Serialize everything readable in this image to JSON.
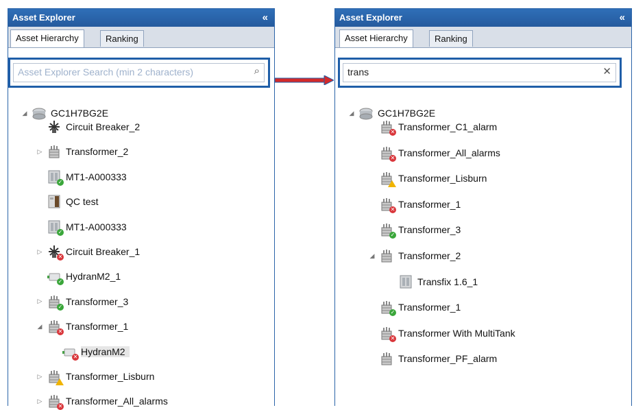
{
  "left": {
    "title": "Asset Explorer",
    "collapse_glyph": "«",
    "tabs": [
      "Asset Hierarchy",
      "Ranking"
    ],
    "search": {
      "placeholder": "Asset Explorer Search (min 2 characters)",
      "value": "",
      "button_icon": "search-icon"
    },
    "root": "GC1H7BG2E",
    "items": [
      {
        "label": "Circuit Breaker_2",
        "icon": "circuit-breaker-icon",
        "status": "none",
        "expander": "none"
      },
      {
        "label": "Transformer_2",
        "icon": "transformer-icon",
        "status": "none",
        "expander": "collapsed"
      },
      {
        "label": "MT1-A000333",
        "icon": "monitor-device-icon",
        "status": "ok",
        "expander": "none"
      },
      {
        "label": "QC test",
        "icon": "cabinet-icon",
        "status": "none",
        "expander": "none"
      },
      {
        "label": "MT1-A000333",
        "icon": "monitor-device-icon",
        "status": "ok",
        "expander": "none"
      },
      {
        "label": "Circuit Breaker_1",
        "icon": "circuit-breaker-icon",
        "status": "error",
        "expander": "collapsed"
      },
      {
        "label": "HydranM2_1",
        "icon": "hydran-sensor-icon",
        "status": "ok",
        "expander": "none"
      },
      {
        "label": "Transformer_3",
        "icon": "transformer-icon",
        "status": "ok",
        "expander": "collapsed"
      },
      {
        "label": "Transformer_1",
        "icon": "transformer-icon",
        "status": "error",
        "expander": "expanded"
      },
      {
        "label": "HydranM2",
        "icon": "hydran-sensor-icon",
        "status": "error",
        "expander": "none",
        "child": true,
        "selected": true
      },
      {
        "label": "Transformer_Lisburn",
        "icon": "transformer-icon",
        "status": "warning",
        "expander": "collapsed"
      },
      {
        "label": "Transformer_All_alarms",
        "icon": "transformer-icon",
        "status": "error",
        "expander": "collapsed"
      }
    ]
  },
  "right": {
    "title": "Asset Explorer",
    "collapse_glyph": "«",
    "tabs": [
      "Asset Hierarchy",
      "Ranking"
    ],
    "search": {
      "placeholder": "",
      "value": "trans",
      "button_icon": "clear-icon"
    },
    "root": "GC1H7BG2E",
    "items": [
      {
        "label": "Transformer_C1_alarm",
        "icon": "transformer-icon",
        "status": "error",
        "expander": "none"
      },
      {
        "label": "Transformer_All_alarms",
        "icon": "transformer-icon",
        "status": "error",
        "expander": "none"
      },
      {
        "label": "Transformer_Lisburn",
        "icon": "transformer-icon",
        "status": "warning",
        "expander": "none"
      },
      {
        "label": "Transformer_1",
        "icon": "transformer-icon",
        "status": "error",
        "expander": "none"
      },
      {
        "label": "Transformer_3",
        "icon": "transformer-icon",
        "status": "ok",
        "expander": "none"
      },
      {
        "label": "Transformer_2",
        "icon": "transformer-icon",
        "status": "none",
        "expander": "expanded"
      },
      {
        "label": "Transfix 1.6_1",
        "icon": "monitor-device-icon",
        "status": "none",
        "expander": "none",
        "child": true
      },
      {
        "label": "Transformer_1",
        "icon": "transformer-icon",
        "status": "ok",
        "expander": "none"
      },
      {
        "label": "Transformer With MultiTank",
        "icon": "transformer-icon",
        "status": "error",
        "expander": "none"
      },
      {
        "label": "Transformer_PF_alarm",
        "icon": "transformer-icon",
        "status": "none",
        "expander": "none"
      }
    ]
  },
  "colors": {
    "title_bar": "#2f6fb8",
    "highlight_border": "#1f5ea8",
    "arrow_red": "#d42a2a",
    "arrow_blue": "#1f5ea8"
  }
}
